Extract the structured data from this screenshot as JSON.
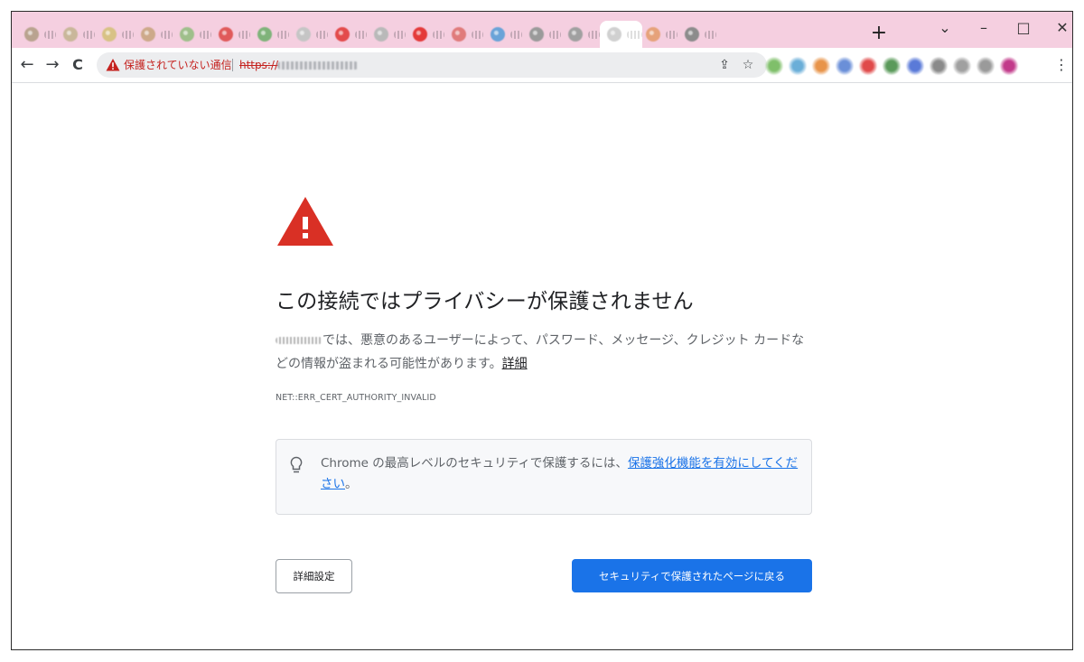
{
  "browser": {
    "tabs": [
      {
        "favicon_color": "#b9a38f",
        "active": false
      },
      {
        "favicon_color": "#c9b79a",
        "active": false
      },
      {
        "favicon_color": "#d8c285",
        "active": false
      },
      {
        "favicon_color": "#cda98a",
        "active": false
      },
      {
        "favicon_color": "#9fbf8b",
        "active": false
      },
      {
        "favicon_color": "#e05a5a",
        "active": false
      },
      {
        "favicon_color": "#7fb37a",
        "active": false
      },
      {
        "favicon_color": "#c5c5c5",
        "active": false
      },
      {
        "favicon_color": "#e34b4b",
        "active": false
      },
      {
        "favicon_color": "#b9b9b9",
        "active": false
      },
      {
        "favicon_color": "#e43a3a",
        "active": false
      },
      {
        "favicon_color": "#e07b7b",
        "active": false
      },
      {
        "favicon_color": "#6aa3d8",
        "active": false
      },
      {
        "favicon_color": "#9a9a9a",
        "active": false
      },
      {
        "favicon_color": "#a0a0a0",
        "active": false
      },
      {
        "favicon_color": "#d0d0d0",
        "active": true
      },
      {
        "favicon_color": "#e6a27a",
        "active": false
      },
      {
        "favicon_color": "#8c8c8c",
        "active": false
      }
    ],
    "new_tab_label": "+",
    "controls": {
      "tab_search": "⌄",
      "minimize": "–",
      "maximize": "□",
      "close": "✕"
    },
    "nav": {
      "back": "←",
      "forward": "→",
      "reload": "C"
    },
    "omnibox": {
      "security_label": "保護されていない通信",
      "url_scheme": "https://"
    },
    "extensions": [
      "#7fbf6a",
      "#6aaed8",
      "#e8944a",
      "#6a8fd8",
      "#e04a4a",
      "#5a9a5a",
      "#5a7ad8",
      "#8a8a8a",
      "#a0a0a0",
      "#9a9a9a",
      "#c23a8a"
    ],
    "menu_label": "⋮"
  },
  "interstitial": {
    "heading": "この接続ではプライバシーが保護されません",
    "description": "では、悪意のあるユーザーによって、パスワード、メッセージ、クレジット カードなどの情報が盗まれる可能性があります。",
    "details_link": "詳細",
    "error_code": "NET::ERR_CERT_AUTHORITY_INVALID",
    "enhanced_text": "Chrome の最高レベルのセキュリティで保護するには、",
    "enhanced_link": "保護強化機能を有効にしてください",
    "enhanced_suffix": "。",
    "advanced_button": "詳細設定",
    "back_button": "セキュリティで保護されたページに戻る",
    "colors": {
      "danger": "#d93025",
      "primary": "#1a73e8",
      "tabstrip": "#f5cfe0"
    }
  }
}
